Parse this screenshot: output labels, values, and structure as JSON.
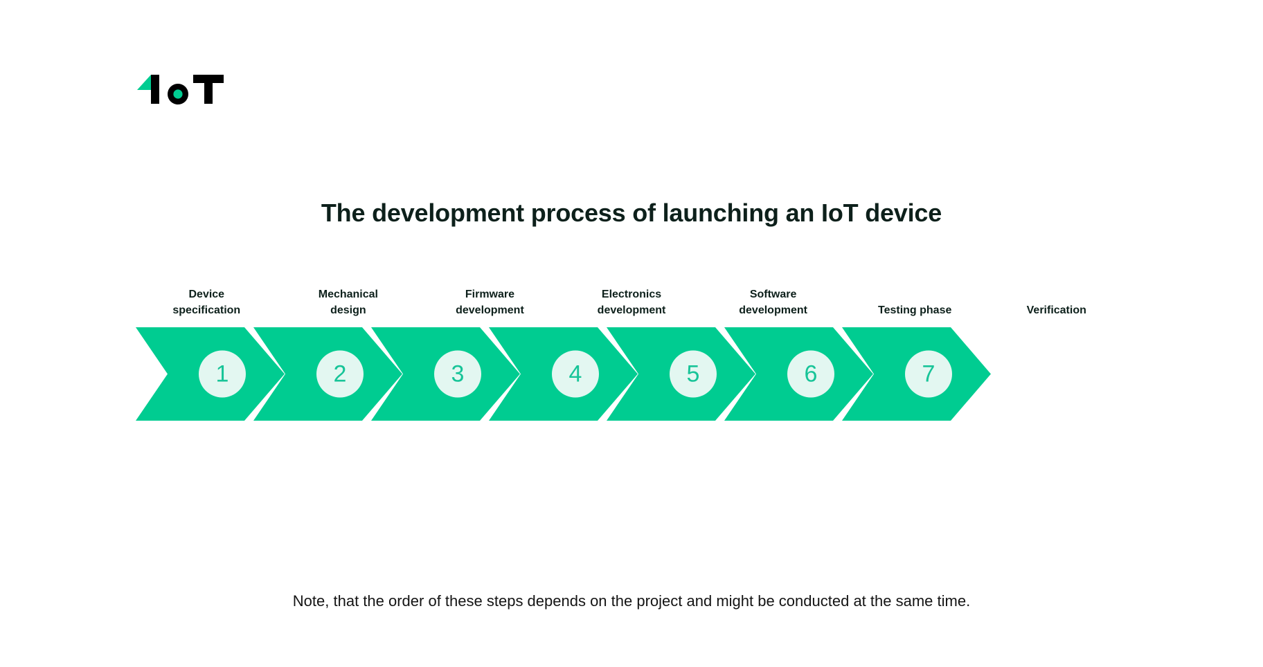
{
  "brand": {
    "logo_text": "IoT",
    "logo_icon": "iot-logo",
    "accent_color": "#00CC91",
    "dark_color": "#000000"
  },
  "title": "The development process of launching an IoT device",
  "note": "Note, that the order of these steps depends on the project and might be conducted at the same time.",
  "colors": {
    "chevron_fill": "#00CC91",
    "circle_fill": "#E3F7F1",
    "number_color": "#17C498",
    "label_color": "#0D201B",
    "title_color": "#0D201B",
    "note_color": "#141414",
    "background": "#FFFFFF"
  },
  "steps": [
    {
      "number": "1",
      "label_line1": "Device",
      "label_line2": "specification"
    },
    {
      "number": "2",
      "label_line1": "Mechanical",
      "label_line2": "design"
    },
    {
      "number": "3",
      "label_line1": "Firmware",
      "label_line2": "development"
    },
    {
      "number": "4",
      "label_line1": "Electronics",
      "label_line2": "development"
    },
    {
      "number": "5",
      "label_line1": "Software",
      "label_line2": "development"
    },
    {
      "number": "6",
      "label_line1": "",
      "label_line2": "Testing phase"
    },
    {
      "number": "7",
      "label_line1": "",
      "label_line2": "Verification"
    }
  ]
}
